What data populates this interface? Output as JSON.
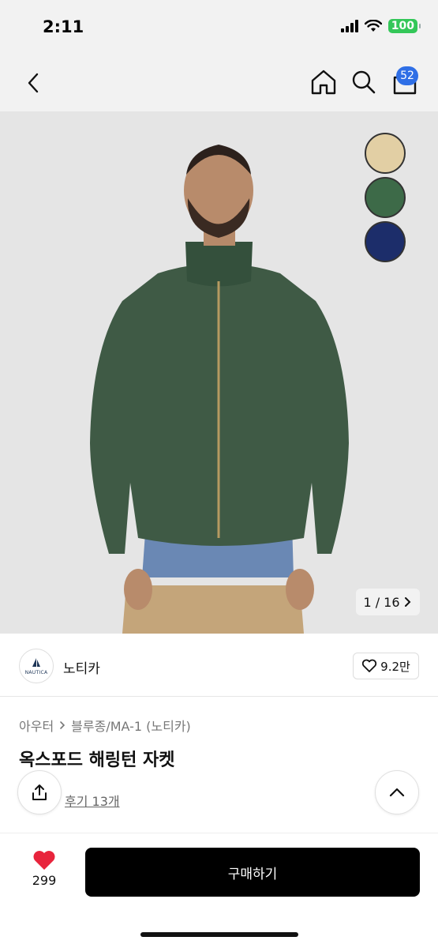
{
  "status_bar": {
    "time": "2:11",
    "battery": "100"
  },
  "nav": {
    "cart_count": "52"
  },
  "hero": {
    "image_counter": "1 / 16",
    "swatches": [
      {
        "name": "beige",
        "color": "#e2cfa4"
      },
      {
        "name": "green",
        "color": "#3d6a48"
      },
      {
        "name": "navy",
        "color": "#1c2d6a"
      }
    ]
  },
  "brand": {
    "logo_text": "NAUTICA",
    "name": "노티카",
    "likes": "9.2만"
  },
  "breadcrumb": {
    "category": "아우터",
    "subcategory": "블루종/MA-1 (노티카)"
  },
  "product": {
    "title": "옥스포드 해링턴 자켓",
    "reviews": "후기 13개"
  },
  "bottom": {
    "wish_count": "299",
    "buy_label": "구매하기"
  },
  "colors": {
    "accent": "#2f6fe6",
    "heart": "#e8243c",
    "battery": "#34c759"
  }
}
